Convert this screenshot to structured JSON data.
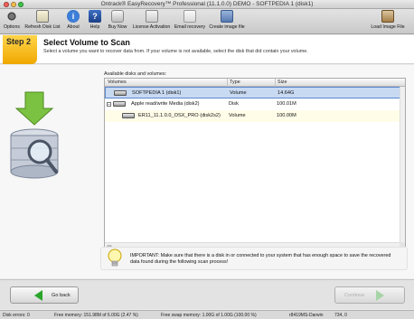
{
  "window": {
    "title": "Ontrack® EasyRecovery™ Professional (11.1.0.0) DEMO - SOFTPEDIA 1 (disk1)"
  },
  "toolbar": {
    "options": "Options",
    "refresh": "Refresh Disk List",
    "about": "About",
    "help": "Help",
    "buy": "Buy Now",
    "license": "License Activation",
    "email": "Email recovery",
    "create_image": "Create image file",
    "load_image": "Load Image File"
  },
  "step": {
    "badge": "Step 2",
    "title": "Select Volume to Scan",
    "description": "Select a volume you want to recover data from. If your volume is not available, select the disk that did contain your volume."
  },
  "volumes": {
    "label": "Available disks and volumes:",
    "columns": [
      "Volumes",
      "Type",
      "Size"
    ],
    "rows": [
      {
        "name": "SOFTPEDIA 1 (disk1)",
        "type": "Volume",
        "size": "14.64G"
      },
      {
        "name": "Apple read/write Media (disk2)",
        "type": "Disk",
        "size": "100.01M"
      },
      {
        "name": "ER11_11.1.0.0_OSX_PRO (disk2s2)",
        "type": "Volume",
        "size": "100.00M"
      }
    ]
  },
  "warning": {
    "text": "IMPORTANT: Make sure that there is a disk in or connected to your system that has enough space to save the recovered data found during the following scan process!"
  },
  "nav": {
    "back": "Go back",
    "next": "Continue"
  },
  "status": {
    "disk_errors": "Disk errors: 0",
    "free_memory": "Free memory: 151.98M of 6.00G (2.47 %)",
    "free_swap": "Free swap memory: 1.00G of 1.00G (100.00 %)",
    "build": "r8419MS-Darwin",
    "code": "734, 0"
  },
  "colors": {
    "step_badge": "#f0a800",
    "selection": "#c8d9f2",
    "nav_arrow": "#2aa52a"
  }
}
